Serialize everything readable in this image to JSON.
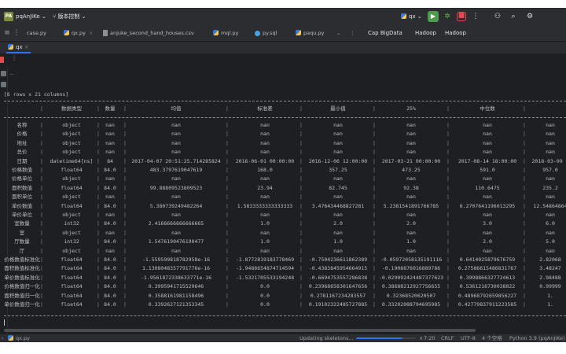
{
  "titlebar": {
    "project_badge": "PA",
    "project_name": "pqAnJiKe",
    "vcs_label": "版本控制",
    "run_config": "qx"
  },
  "tabs": [
    {
      "label": "case.py",
      "icon": "python-file-icon"
    },
    {
      "label": "qx.py",
      "icon": "python-file-icon"
    },
    {
      "label": "anjuke_second_hand_houses.csv",
      "icon": "csv-file-icon"
    },
    {
      "label": "mql.py",
      "icon": "python-file-icon"
    },
    {
      "label": "py.sql",
      "icon": "sql-file-icon"
    },
    {
      "label": "paqu.py",
      "icon": "python-file-icon"
    }
  ],
  "bigdata_tabs": [
    "Cap BigData",
    "Hadoop",
    "Hadoop"
  ],
  "run_tab": {
    "label": "qx"
  },
  "console": {
    "rows_info": "[6 rows x 21 columns]",
    "table_headers": [
      "",
      "数据类型",
      "数量",
      "均值",
      "标准差",
      "最小值",
      "25%",
      "中位数",
      ""
    ],
    "table_rows": [
      [
        "名称",
        "object",
        "nan",
        "nan",
        "nan",
        "nan",
        "nan",
        "nan",
        "nan"
      ],
      [
        "价格",
        "object",
        "nan",
        "nan",
        "nan",
        "nan",
        "nan",
        "nan",
        "nan"
      ],
      [
        "地址",
        "object",
        "nan",
        "nan",
        "nan",
        "nan",
        "nan",
        "nan",
        "nan"
      ],
      [
        "总价",
        "object",
        "nan",
        "nan",
        "nan",
        "nan",
        "nan",
        "nan",
        "nan"
      ],
      [
        "日期",
        "datetime64[ns]",
        "84",
        "2017-04-07 20:51:25.714285824",
        "2016-06-01 00:00:00",
        "2016-12-06 12:00:00",
        "2017-03-21 00:00:00",
        "2017-08-14 18:00:00",
        "2018-03-09 0"
      ],
      [
        "价格数值",
        "float64",
        "84.0",
        "483.3797619047619",
        "168.0",
        "357.25",
        "473.25",
        "591.0",
        "957.0"
      ],
      [
        "价格单位",
        "object",
        "nan",
        "nan",
        "nan",
        "nan",
        "nan",
        "nan",
        "nan"
      ],
      [
        "面积数值",
        "float64",
        "84.0",
        "99.88809523809523",
        "23.94",
        "82.745",
        "92.38",
        "110.6475",
        "235.2"
      ],
      [
        "面积单位",
        "object",
        "nan",
        "nan",
        "nan",
        "nan",
        "nan",
        "nan",
        "nan"
      ],
      [
        "单价数值",
        "float64",
        "84.0",
        "5.380739249482264",
        "1.5833333333333333",
        "3.476434468827281",
        "5.2381541891766785",
        "6.2707641196013295",
        "12.54864864"
      ],
      [
        "单价单位",
        "object",
        "nan",
        "nan",
        "nan",
        "nan",
        "nan",
        "nan",
        "nan"
      ],
      [
        "室数量",
        "int32",
        "84.0",
        "2.4166666666666665",
        "1.0",
        "2.0",
        "2.0",
        "3.0",
        "6.0"
      ],
      [
        "室",
        "object",
        "nan",
        "nan",
        "nan",
        "nan",
        "nan",
        "nan",
        "nan"
      ],
      [
        "厅数量",
        "int32",
        "84.0",
        "1.5476190476190477",
        "1.0",
        "1.0",
        "1.0",
        "2.0",
        "5.0"
      ],
      [
        "厅",
        "object",
        "nan",
        "nan",
        "nan",
        "nan",
        "nan",
        "nan",
        "nan"
      ],
      [
        "价格数值标准化",
        "float64",
        "84.0",
        "-1.559599818782958e-16",
        "-1.8772819183778469",
        "-0.7504236611862389",
        "-0.05972058135191116",
        "0.6414025879676759",
        "2.82068"
      ],
      [
        "面积数值标准化",
        "float64",
        "84.0",
        "1.1308048357791776e-16",
        "-1.9488654874714594",
        "-0.4383845954664915",
        "-0.1908876016889786",
        "0.27586615486831767",
        "3.48247"
      ],
      [
        "单价数值标准化",
        "float64",
        "84.0",
        "-1.9561872338633771e-16",
        "-1.5321705533194248",
        "-0.6694753557286838",
        "-0.029092424487377623",
        "0.3998866327724613",
        "2.98488"
      ],
      [
        "价格数值归一化",
        "float64",
        "84.0",
        "0.3995941715529646",
        "0.0",
        "0.23968658301647656",
        "0.38688212927756655",
        "0.5361216730038022",
        "0.99999"
      ],
      [
        "面积数值归一化",
        "float64",
        "84.0",
        "0.3588161981158496",
        "0.0",
        "0.2781167234283557",
        "0.32368520620507",
        "0.48968792659856227",
        "1."
      ],
      [
        "单价数值归一化",
        "float64",
        "84.0",
        "0.3392627121353345",
        "0.0",
        "0.19102322485727885",
        "0.33202088794695985",
        "0.42779837911223585",
        "1."
      ]
    ]
  },
  "statusbar": {
    "left_path": "qx.py",
    "progress_label": "Updating skeletons...",
    "progress_fraction": 0.78,
    "position": "7:20",
    "line_sep": "CRLF",
    "encoding": "UTF-8",
    "indent": "4 个空格",
    "interpreter": "Python 3.9 (pqAnJiKe)"
  }
}
